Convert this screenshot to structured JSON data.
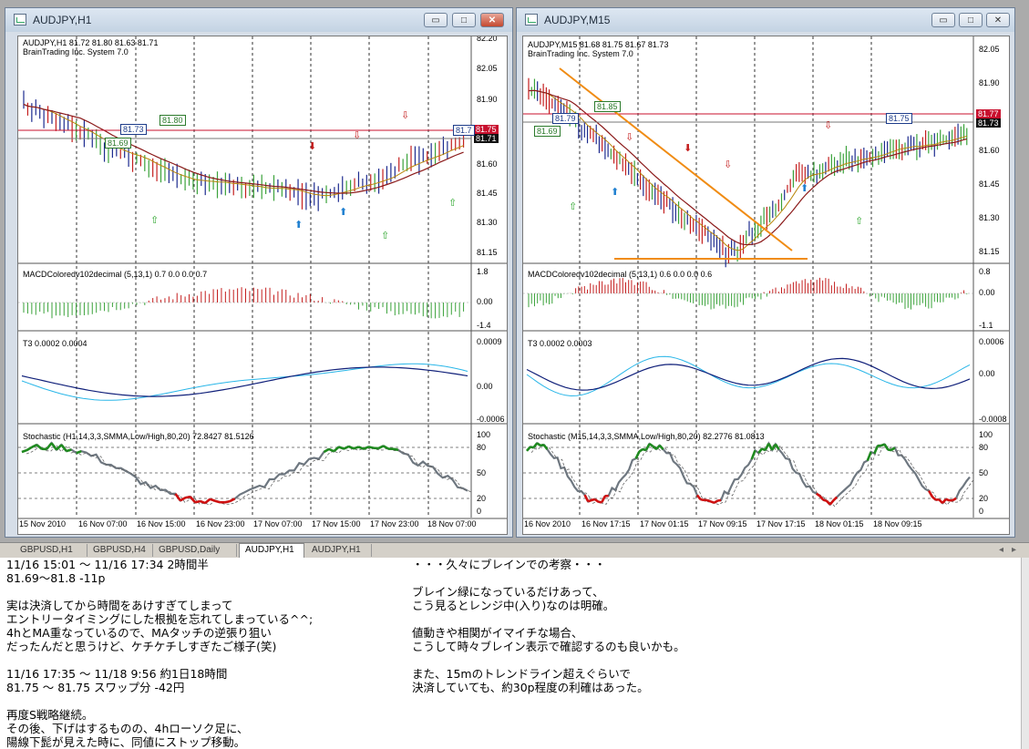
{
  "left_window": {
    "title": "AUDJPY,H1",
    "header_line1": "AUDJPY,H1  81.72 81.80 81.63 81.71",
    "header_line2": "BrainTrading Inc. System 7.0",
    "price_ticks": [
      "82.20",
      "82.05",
      "81.90",
      "81.75",
      "81.60",
      "81.45",
      "81.30",
      "81.15"
    ],
    "price_tag_red": "81.75",
    "price_tag_black": "81.71",
    "box_labels": [
      "81.80",
      "81.73",
      "81.69",
      "81.7"
    ],
    "macd_label": "MACDColoredv102decimal (5,13,1) 0.7 0.0 0.0 0.7",
    "macd_ticks": [
      "1.8",
      "0.00",
      "-1.4"
    ],
    "t3_label": "T3 0.0002 0.0004",
    "t3_ticks": [
      "0.0009",
      "0.00",
      "-0.0006"
    ],
    "stoch_label": "Stochastic (H1,14,3,3,SMMA,Low/High,80,20) 72.8427 81.5126",
    "stoch_ticks": [
      "100",
      "80",
      "50",
      "20",
      "0"
    ],
    "time_ticks": [
      "15 Nov 2010",
      "16 Nov 07:00",
      "16 Nov 15:00",
      "16 Nov 23:00",
      "17 Nov 07:00",
      "17 Nov 15:00",
      "17 Nov 23:00",
      "18 Nov 07:00"
    ]
  },
  "right_window": {
    "title": "AUDJPY,M15",
    "header_line1": "AUDJPY,M15  81.68 81.75 81.67 81.73",
    "header_line2": "BrainTrading Inc. System 7.0",
    "price_ticks": [
      "82.05",
      "81.90",
      "81.75",
      "81.60",
      "81.45",
      "81.30",
      "81.15"
    ],
    "price_tag_red": "81.77",
    "price_tag_black": "81.73",
    "box_labels": [
      "81.85",
      "81.79",
      "81.69",
      "81.75"
    ],
    "macd_label": "MACDColoredv102decimal (5,13,1) 0.6 0.0 0.0 0.6",
    "macd_ticks": [
      "0.8",
      "0.00",
      "-1.1"
    ],
    "t3_label": "T3 0.0002 0.0003",
    "t3_ticks": [
      "0.0006",
      "0.00",
      "-0.0008"
    ],
    "stoch_label": "Stochastic (M15,14,3,3,SMMA,Low/High,80,20) 82.2776 81.0813",
    "stoch_ticks": [
      "100",
      "80",
      "50",
      "20",
      "0"
    ],
    "time_ticks": [
      "16 Nov 2010",
      "16 Nov 17:15",
      "17 Nov 01:15",
      "17 Nov 09:15",
      "17 Nov 17:15",
      "18 Nov 01:15",
      "18 Nov 09:15"
    ]
  },
  "tabs": [
    "GBPUSD,H1",
    "GBPUSD,H4",
    "GBPUSD,Daily",
    "AUDJPY,H1",
    "AUDJPY,H1"
  ],
  "active_tab": 3,
  "notes_left": [
    "11/16 15:01 ～ 11/16 17:34  2時間半",
    "81.69～81.8  -11p",
    "",
    "実は決済してから時間をあけすぎてしまって",
    "エントリータイミングにした根拠を忘れてしまっている^^;",
    "4hとMA重なっているので、MAタッチの逆張り狙い",
    "だったんだと思うけど、ケチケチしすぎたご様子(笑)",
    "",
    "11/16 17:35 ～ 11/18 9:56 約1日18時間",
    "81.75 ～ 81.75 スワップ分 -42円",
    "",
    "再度S戦略継続。",
    "その後、下げはするものの、4hローソク足に、",
    "陽線下髭が見えた時に、同値にストップ移動。"
  ],
  "notes_right": [
    "・・・久々にブレインでの考察・・・",
    "",
    "ブレイン緑になっているだけあって、",
    "こう見るとレンジ中(入り)なのは明確。",
    "",
    "値動きや相関がイマイチな場合、",
    "こうして時々ブレイン表示で確認するのも良いかも。",
    "",
    "また、15mのトレンドライン超えぐらいで",
    "決済していても、約30p程度の利確はあった。"
  ],
  "colors": {
    "bull_bar": "#1d2b8f",
    "bear_bar": "#c41e1e",
    "neutral_bar": "#3aa23a",
    "stoch_main": "#6e7780",
    "stoch_overbought": "#1f8a1f",
    "stoch_oversold": "#d01010",
    "trendline": "#f08c14",
    "price_red": "#c8102e"
  }
}
